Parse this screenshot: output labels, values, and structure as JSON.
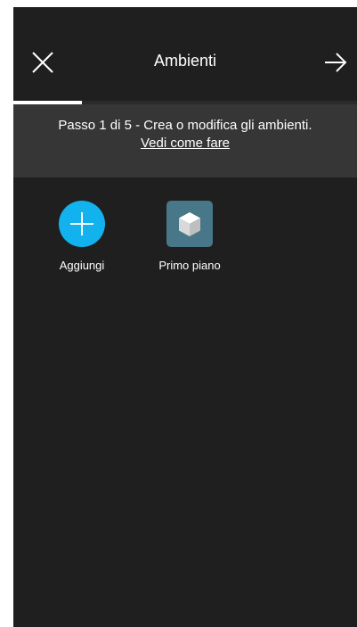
{
  "header": {
    "title": "Ambienti",
    "close_icon": "close-icon",
    "next_icon": "arrow-right-icon"
  },
  "progress": {
    "current_step": 1,
    "total_steps": 5,
    "fraction": 0.2
  },
  "info": {
    "step_text": "Passo 1 di 5 - Crea o modifica gli ambienti.",
    "help_link": "Vedi come fare"
  },
  "rooms": {
    "add": {
      "label": "Aggiungi",
      "icon": "plus-icon",
      "color": "#12b2ef"
    },
    "items": [
      {
        "label": "Primo piano",
        "icon": "cube-icon",
        "color": "#477788"
      }
    ]
  },
  "colors": {
    "background": "#1f1f1f",
    "info_band": "#363636",
    "accent": "#12b2ef"
  }
}
